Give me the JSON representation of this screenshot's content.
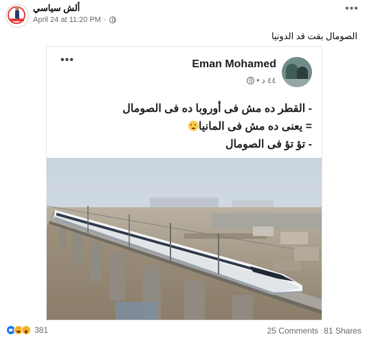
{
  "post": {
    "author": "ألش سياسي",
    "timestamp": "April 24 at 11:20 PM",
    "separator": "·",
    "caption": "الصومال بقت قد الدونيا"
  },
  "shared": {
    "name": "Eman Mohamed",
    "time": "٤٤ د",
    "dot": "•",
    "lines": [
      "- القطر ده مش فى أوروبا ده فى الصومال",
      "= يعنى ده مش فى المانيا",
      "- تؤ تؤ فى الصومال"
    ],
    "emoji": "thinking-face-icon"
  },
  "footer": {
    "reactions": [
      "like-icon",
      "haha-icon",
      "wow-icon"
    ],
    "reaction_count": "381",
    "comments": "25 Comments",
    "shares": "81 Shares"
  },
  "colors": {
    "link_blue": "#1877f2",
    "meta_gray": "#65676b",
    "sky": "#cfd8e2",
    "train_white": "#f4f6f8"
  }
}
